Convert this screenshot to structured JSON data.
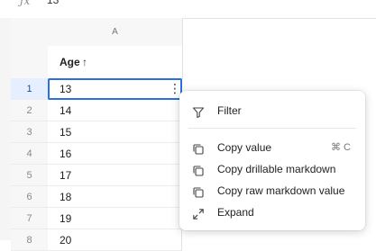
{
  "formula_bar": {
    "fx_label": "ƒx",
    "value": "13"
  },
  "column": {
    "letter": "A",
    "title": "Age",
    "sort_icon": "arrow-up-icon",
    "sort_glyph": "↑"
  },
  "rows": [
    {
      "num": "1",
      "value": "13"
    },
    {
      "num": "2",
      "value": "14"
    },
    {
      "num": "3",
      "value": "15"
    },
    {
      "num": "4",
      "value": "16"
    },
    {
      "num": "5",
      "value": "17"
    },
    {
      "num": "6",
      "value": "18"
    },
    {
      "num": "7",
      "value": "19"
    },
    {
      "num": "8",
      "value": "20"
    }
  ],
  "active_row": "1",
  "cell_menu_glyph": "⋮",
  "context_menu": {
    "items": [
      {
        "label": "Filter",
        "icon": "filter-icon",
        "shortcut": ""
      },
      {
        "label": "Copy value",
        "icon": "copy-icon",
        "shortcut": "⌘ C"
      },
      {
        "label": "Copy drillable markdown",
        "icon": "copy-icon",
        "shortcut": ""
      },
      {
        "label": "Copy raw markdown value",
        "icon": "copy-icon",
        "shortcut": ""
      },
      {
        "label": "Expand",
        "icon": "expand-icon",
        "shortcut": ""
      }
    ]
  },
  "colors": {
    "accent": "#2c6fe0",
    "active_row_bg": "#e5efff"
  }
}
